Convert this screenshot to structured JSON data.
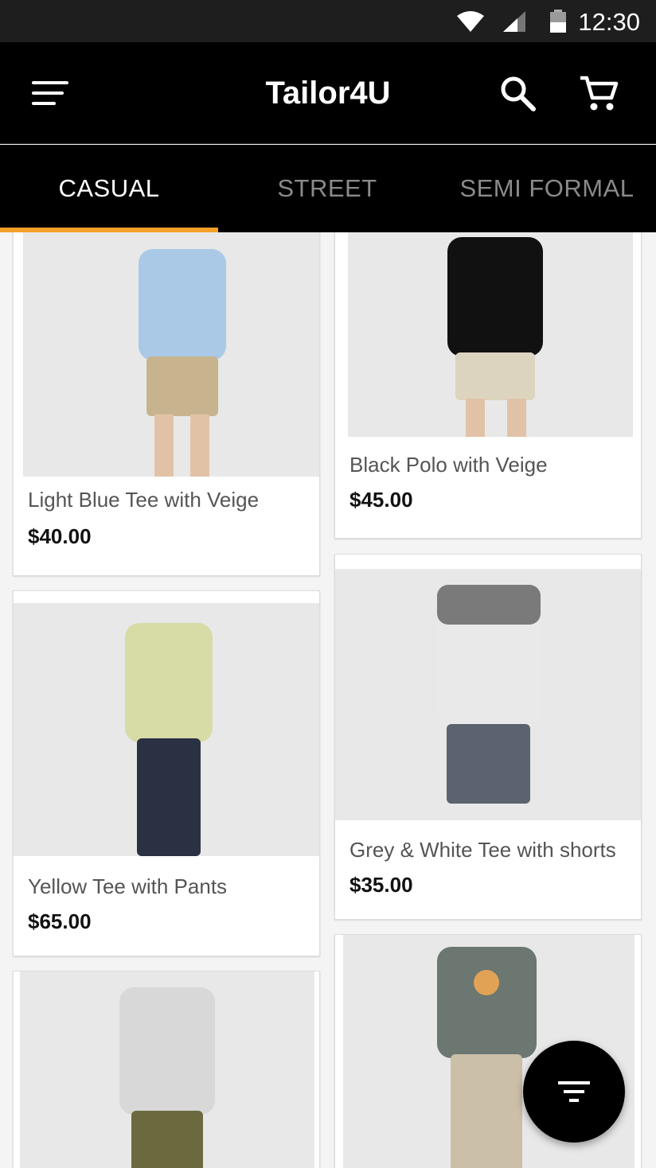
{
  "status_bar": {
    "time": "12:30"
  },
  "app_bar": {
    "title": "Tailor4U"
  },
  "tabs": [
    {
      "label": "CASUAL",
      "active": true
    },
    {
      "label": "STREET",
      "active": false
    },
    {
      "label": "SEMI FORMAL",
      "active": false
    }
  ],
  "products": [
    {
      "name": "Light Blue Tee with Veige",
      "price": "$40.00",
      "shirt_color": "#a9c9e6",
      "bottom_color": "#c7b48f"
    },
    {
      "name": "Black Polo with Veige",
      "price": "$45.00",
      "shirt_color": "#111111",
      "bottom_color": "#ddd4c0"
    },
    {
      "name": "Yellow Tee with Pants",
      "price": "$65.00",
      "shirt_color": "#d7dba6",
      "bottom_color": "#2a3142"
    },
    {
      "name": "Grey & White Tee with shorts",
      "price": "$35.00",
      "shirt_color": "#e9e9e9",
      "bottom_color": "#5b6270"
    },
    {
      "name": "",
      "price": "",
      "shirt_color": "#d8d8d8",
      "bottom_color": "#6b6a3e"
    },
    {
      "name": "",
      "price": "",
      "shirt_color": "#6b7770",
      "bottom_color": "#cbbfa8"
    }
  ],
  "colors": {
    "accent": "#f2a02a",
    "app_bar": "#000000",
    "status_bar": "#1e1e1e"
  },
  "icons": {
    "menu": "menu-icon",
    "search": "search-icon",
    "cart": "cart-icon",
    "filter": "filter-icon"
  }
}
